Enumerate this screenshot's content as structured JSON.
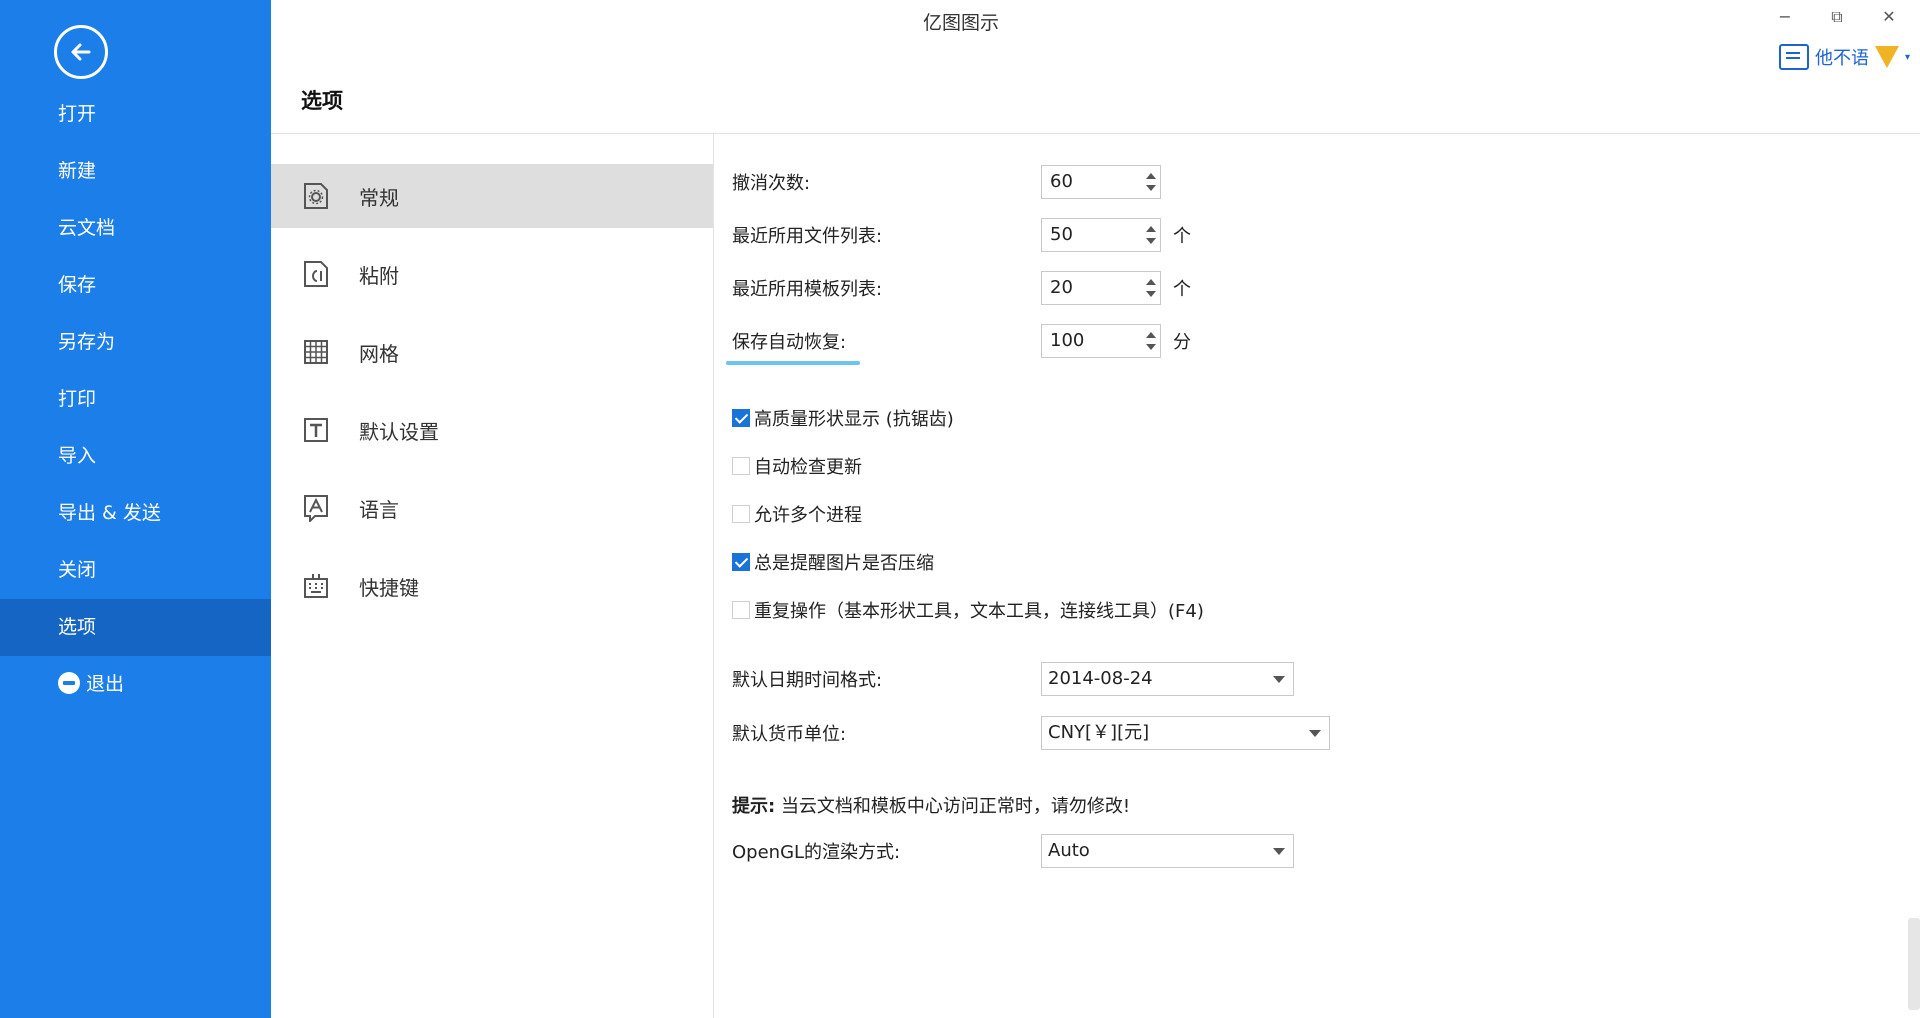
{
  "app": {
    "title": "亿图图示",
    "window": {
      "minimize": "−",
      "restore": "⧉",
      "close": "✕"
    }
  },
  "user": {
    "name": "他不语",
    "caret": "▾"
  },
  "sidebar": {
    "items": [
      {
        "label": "打开"
      },
      {
        "label": "新建"
      },
      {
        "label": "云文档"
      },
      {
        "label": "保存"
      },
      {
        "label": "另存为"
      },
      {
        "label": "打印"
      },
      {
        "label": "导入"
      },
      {
        "label": "导出 & 发送"
      },
      {
        "label": "关闭"
      },
      {
        "label": "选项",
        "active": true
      },
      {
        "label": "退出"
      }
    ]
  },
  "page": {
    "title": "选项"
  },
  "categories": [
    {
      "label": "常规",
      "icon": "gear-doc-icon",
      "active": true
    },
    {
      "label": "粘附",
      "icon": "glue-icon"
    },
    {
      "label": "网格",
      "icon": "grid-icon"
    },
    {
      "label": "默认设置",
      "icon": "text-default-icon"
    },
    {
      "label": "语言",
      "icon": "language-icon"
    },
    {
      "label": "快捷键",
      "icon": "keyboard-icon"
    }
  ],
  "settings": {
    "undo_label": "撤消次数:",
    "undo_value": "60",
    "recent_files_label": "最近所用文件列表:",
    "recent_files_value": "50",
    "recent_files_unit": "个",
    "recent_templates_label": "最近所用模板列表:",
    "recent_templates_value": "20",
    "recent_templates_unit": "个",
    "autosave_label": "保存自动恢复:",
    "autosave_value": "100",
    "autosave_unit": "分",
    "checks": [
      {
        "label": "高质量形状显示 (抗锯齿)",
        "checked": true
      },
      {
        "label": "自动检查更新",
        "checked": false
      },
      {
        "label": "允许多个进程",
        "checked": false
      },
      {
        "label": "总是提醒图片是否压缩",
        "checked": true
      },
      {
        "label": "重复操作（基本形状工具，文本工具，连接线工具）(F4)",
        "checked": false
      }
    ],
    "date_format_label": "默认日期时间格式:",
    "date_format_value": "2014-08-24",
    "currency_label": "默认货币单位:",
    "currency_value": "CNY[￥][元]",
    "tip_bold": "提示:",
    "tip_text": "当云文档和模板中心访问正常时，请勿修改!",
    "opengl_label": "OpenGL的渲染方式:",
    "opengl_value": "Auto"
  }
}
